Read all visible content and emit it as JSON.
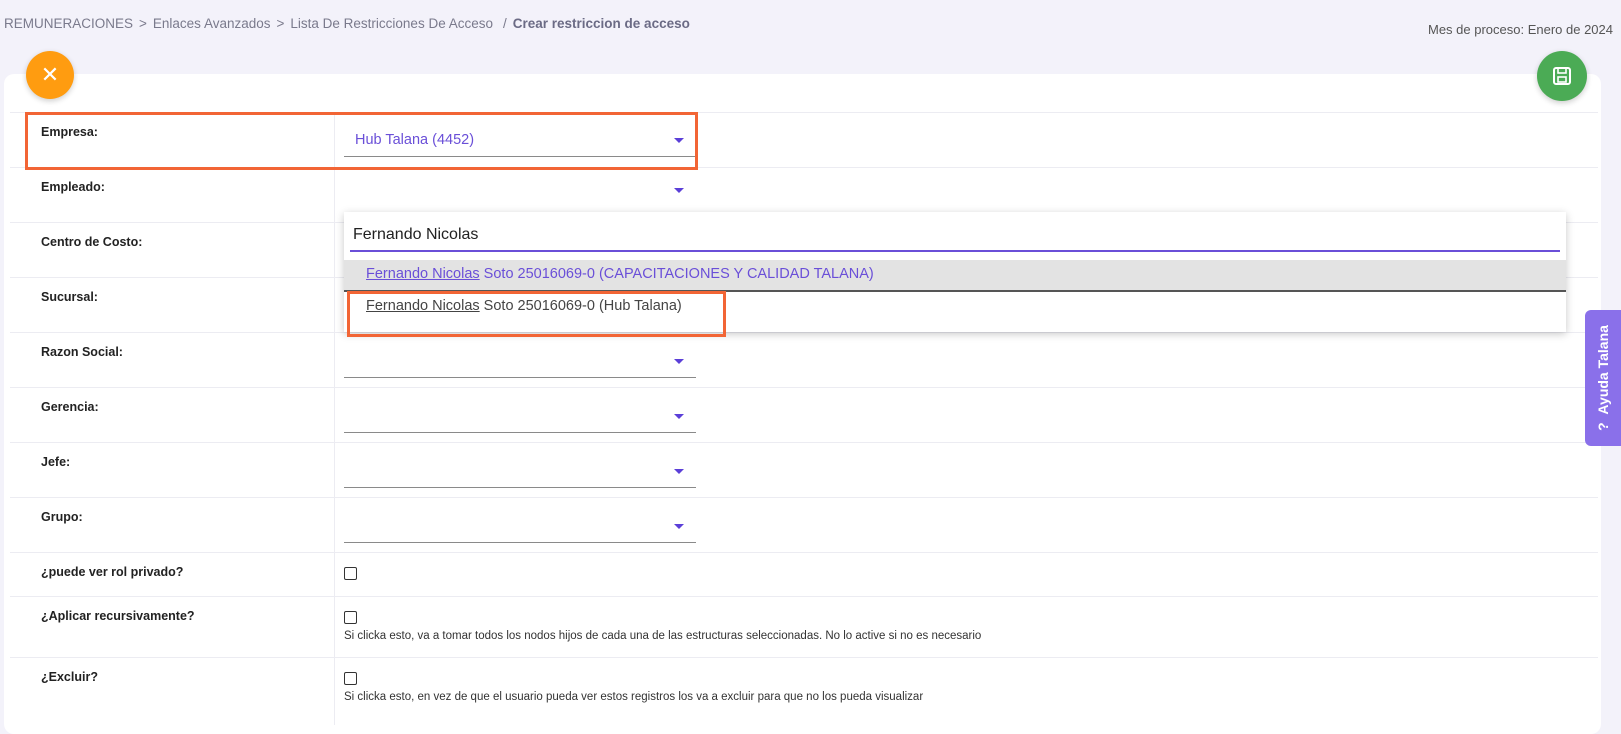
{
  "breadcrumb": {
    "items": [
      "REMUNERACIONES",
      "Enlaces Avanzados",
      "Lista De Restricciones De Acceso"
    ],
    "current": "Crear restriccion de acceso"
  },
  "process_month": "Mes de proceso: Enero de 2024",
  "actions": {
    "close_icon": "close-icon",
    "save_icon": "save-icon"
  },
  "form": {
    "empresa": {
      "label": "Empresa:",
      "value": "Hub Talana (4452)"
    },
    "empleado": {
      "label": "Empleado:",
      "value": ""
    },
    "centro_costo": {
      "label": "Centro de Costo:"
    },
    "sucursal": {
      "label": "Sucursal:"
    },
    "razon_social": {
      "label": "Razon Social:",
      "value": ""
    },
    "gerencia": {
      "label": "Gerencia:",
      "value": ""
    },
    "jefe": {
      "label": "Jefe:",
      "value": ""
    },
    "grupo": {
      "label": "Grupo:",
      "value": ""
    },
    "rol_privado": {
      "label": "¿puede ver rol privado?"
    },
    "recursivo": {
      "label": "¿Aplicar recursivamente?",
      "hint": "Si clicka esto, va a tomar todos los nodos hijos de cada una de las estructuras seleccionadas. No lo active si no es necesario"
    },
    "excluir": {
      "label": "¿Excluir?",
      "hint": "Si clicka esto, en vez de que el usuario pueda ver estos registros los va a excluir para que no los pueda visualizar"
    }
  },
  "dropdown": {
    "search_value": "Fernando Nicolas",
    "options": [
      {
        "match": "Fernando Nicolas",
        "rest": " Soto 25016069-0 (CAPACITACIONES Y CALIDAD TALANA)"
      },
      {
        "match": "Fernando Nicolas",
        "rest": " Soto 25016069-0 (Hub Talana)"
      }
    ]
  },
  "help_tab": {
    "label": "Ayuda Talana",
    "icon": "?"
  },
  "colors": {
    "accent": "#6a4fd8",
    "close": "#ff9c10",
    "save": "#4bab55",
    "highlight": "#f26535",
    "help": "#8a70ea"
  }
}
